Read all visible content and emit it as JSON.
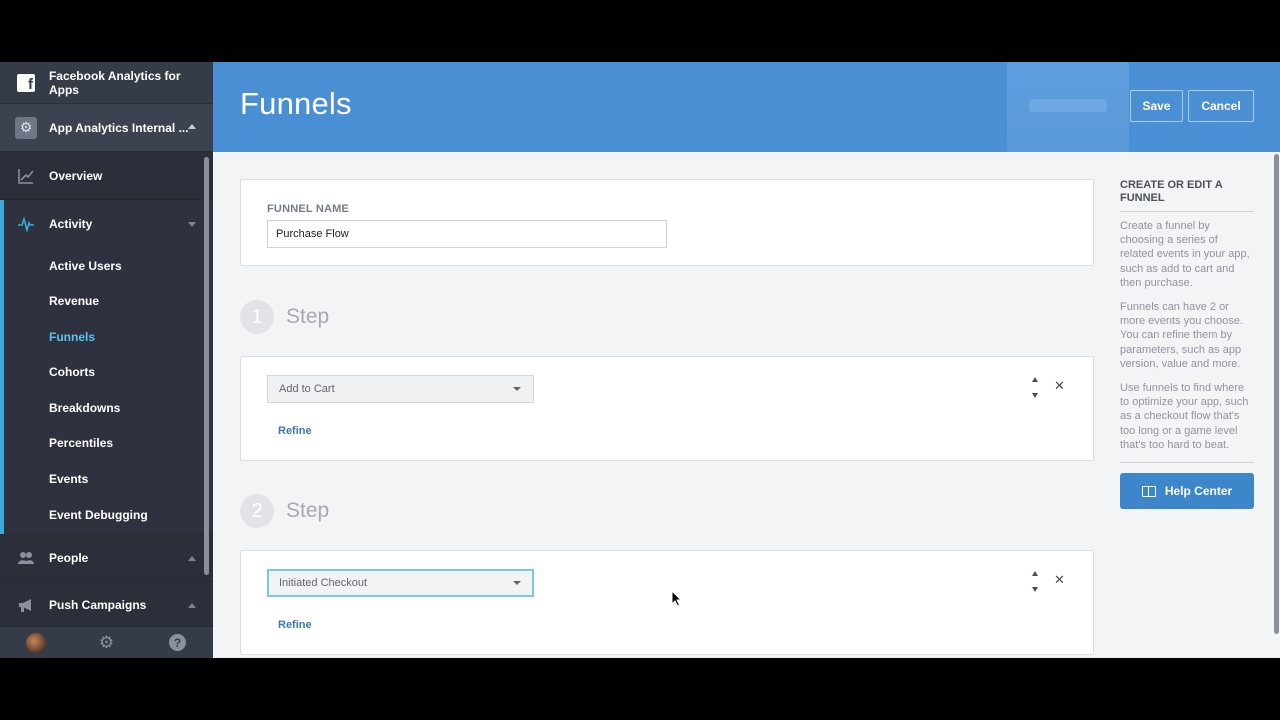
{
  "sidebar": {
    "app_brand": "Facebook Analytics for Apps",
    "app_selector": "App Analytics Internal ...",
    "overview": "Overview",
    "activity": {
      "label": "Activity",
      "items": [
        {
          "label": "Active Users"
        },
        {
          "label": "Revenue"
        },
        {
          "label": "Funnels",
          "active": true
        },
        {
          "label": "Cohorts"
        },
        {
          "label": "Breakdowns"
        },
        {
          "label": "Percentiles"
        },
        {
          "label": "Events"
        },
        {
          "label": "Event Debugging"
        }
      ]
    },
    "people": "People",
    "push_campaigns": "Push Campaigns",
    "footer_icons": [
      "avatar",
      "gear-icon",
      "help-icon"
    ]
  },
  "header": {
    "title": "Funnels",
    "save_label": "Save",
    "cancel_label": "Cancel",
    "accent_color": "#4a8fd4"
  },
  "funnel_name": {
    "label": "FUNNEL NAME",
    "value": "Purchase Flow"
  },
  "steps": [
    {
      "number": "1",
      "label": "Step",
      "event": "Add to Cart",
      "refine_label": "Refine"
    },
    {
      "number": "2",
      "label": "Step",
      "event": "Initiated Checkout",
      "refine_label": "Refine",
      "focused": true
    }
  ],
  "info_panel": {
    "title": "CREATE OR EDIT A FUNNEL",
    "paragraphs": [
      "Create a funnel by choosing a series of related events in your app, such as add to cart and then purchase.",
      "Funnels can have 2 or more events you choose. You can refine them by parameters, such as app version, value and more.",
      "Use funnels to find where to optimize your app, such as a checkout flow that's too long or a game level that's too hard to beat."
    ],
    "help_button": "Help Center"
  }
}
